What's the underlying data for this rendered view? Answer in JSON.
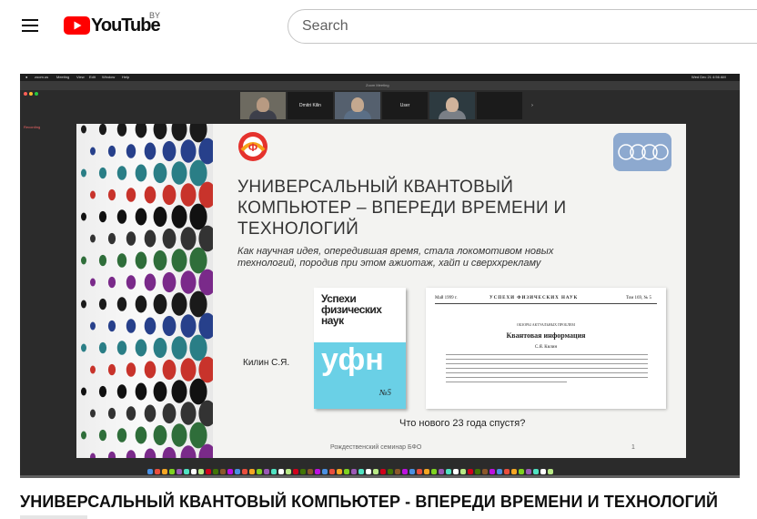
{
  "header": {
    "logo_text": "YouTube",
    "region": "BY",
    "search_placeholder": "Search"
  },
  "player": {
    "mac_menu": [
      "zoom.us",
      "Meeting",
      "View",
      "Edit",
      "Window",
      "Help"
    ],
    "mac_clock": "Wed Dec 21  4:56 AM",
    "zoom_window_title": "Zoom Meeting",
    "recording_label": "Recording",
    "participants": [
      {
        "name": "Dmitri Kilin"
      },
      {
        "name": "User"
      }
    ],
    "slide": {
      "title": "УНИВЕРСАЛЬНЫЙ КВАНТОВЫЙ КОМПЬЮТЕР –  ВПЕРЕДИ ВРЕМЕНИ И ТЕХНОЛОГИЙ",
      "subtitle": "Как научная идея, опередившая время, стала локомотивом новых технологий, породив при этом ажиотаж, хайп и сверххрекламу",
      "author": "Килин С.Я.",
      "journal_title": "Успехи физических наук",
      "journal_cover_text": "уфн",
      "journal_issue": "№5",
      "paper_header_left": "Май 1999 г.",
      "paper_header_center": "УСПЕХИ ФИЗИЧЕСКИХ НАУК",
      "paper_header_right": "Том 169, № 5",
      "paper_section": "ОБЗОРЫ АКТУАЛЬНЫХ ПРОБЛЕМ",
      "paper_title": "Квантовая информация",
      "paper_author": "С.Я. Килин",
      "question": "Что нового 23 года спустя?",
      "footer_left": "Рождественский семинар БФО",
      "footer_right": "1"
    }
  },
  "video": {
    "title": "УНИВЕРСАЛЬНЫЙ КВАНТОВЫЙ КОМПЬЮТЕР - ВПЕРЕДИ ВРЕМЕНИ И ТЕХНОЛОГИЙ"
  },
  "colors": {
    "brand_red": "#ff0000",
    "text": "#0f0f0f",
    "journal_cyan": "#6ad0e6"
  }
}
